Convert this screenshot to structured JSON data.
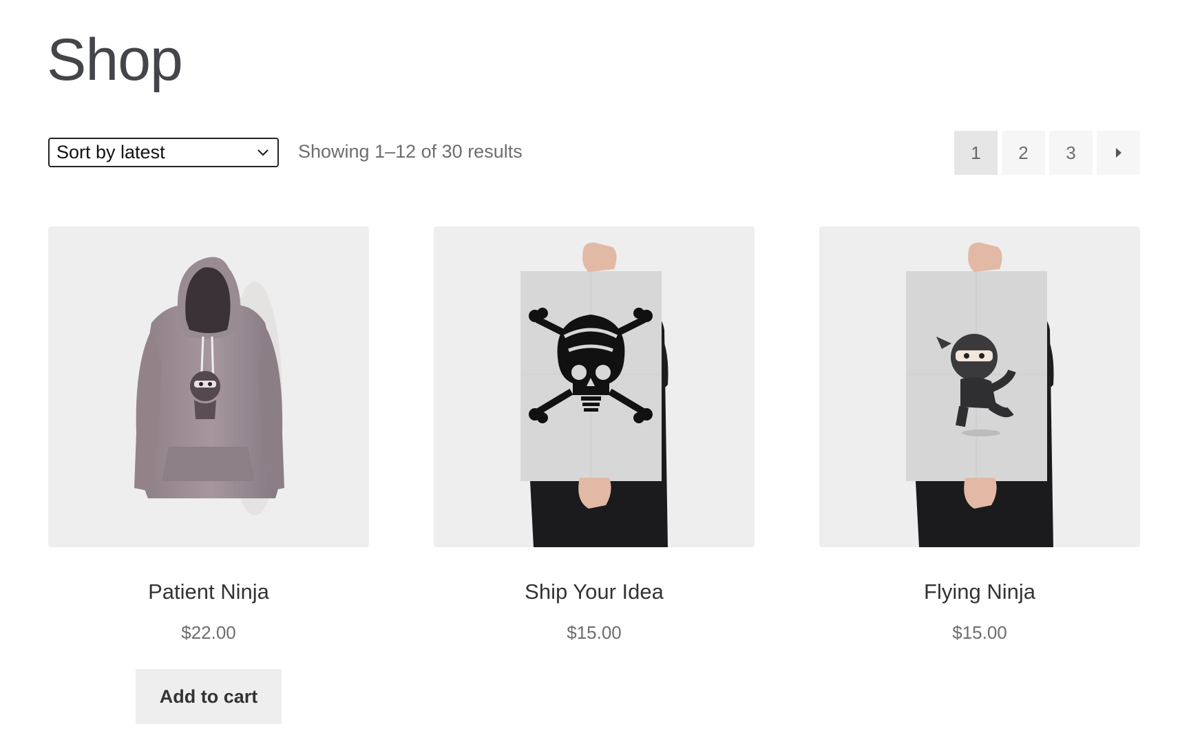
{
  "page": {
    "title": "Shop"
  },
  "toolbar": {
    "sort_label": "Sort by latest",
    "result_count": "Showing 1–12 of 30 results"
  },
  "pagination": {
    "pages": [
      "1",
      "2",
      "3"
    ],
    "current": "1",
    "next_icon": "triangle-right-icon"
  },
  "products": [
    {
      "title": "Patient Ninja",
      "price": "$22.00",
      "button": "Add to cart",
      "image": "hoodie-ninja-image"
    },
    {
      "title": "Ship Your Idea",
      "price": "$15.00",
      "image": "skull-poster-image"
    },
    {
      "title": "Flying Ninja",
      "price": "$15.00",
      "image": "ninja-poster-image"
    }
  ],
  "colors": {
    "image_bg": "#eeeeee",
    "button_bg": "#eeeeee",
    "price_text": "#6d6d6d"
  }
}
